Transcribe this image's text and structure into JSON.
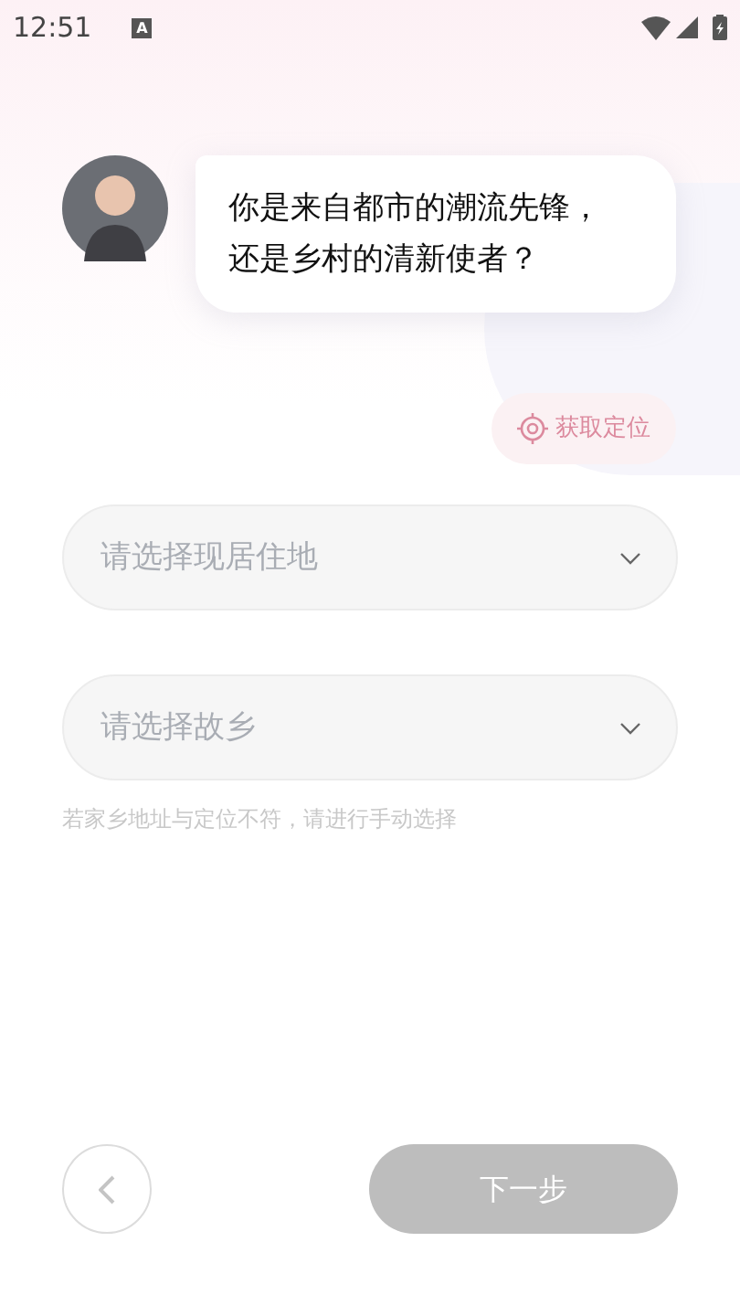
{
  "status_bar": {
    "time": "12:51",
    "notification": "A"
  },
  "question": {
    "text": "你是来自都市的潮流先锋，还是乡村的清新使者？"
  },
  "locate_button": {
    "label": "获取定位"
  },
  "fields": [
    {
      "placeholder": "请选择现居住地"
    },
    {
      "placeholder": "请选择故乡"
    }
  ],
  "hint": "若家乡地址与定位不符，请进行手动选择",
  "next_button": {
    "label": "下一步",
    "disabled": true
  }
}
